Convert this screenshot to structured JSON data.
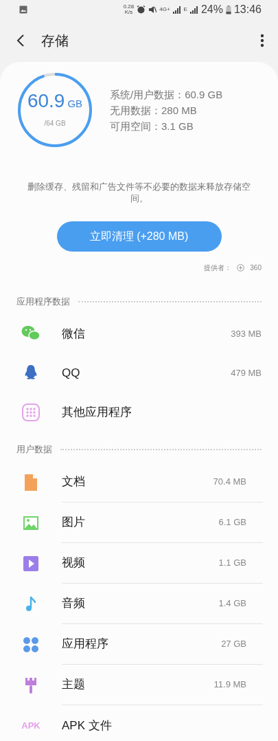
{
  "status_bar": {
    "speed": "0.28",
    "speed_unit": "K/s",
    "network": "4G+",
    "network2": "E",
    "battery": "24%",
    "time": "13:46"
  },
  "header": {
    "title": "存储"
  },
  "summary": {
    "used": "60.9",
    "used_unit": "GB",
    "total": "/64 GB",
    "level": 0.95,
    "details": [
      "系统/用户数据：60.9 GB",
      "无用数据：280 MB",
      "可用空间：3.1 GB"
    ],
    "description": "删除缓存、残留和广告文件等不必要的数据来释放存储空间。",
    "clean_button": "立即清理 (+280 MB)",
    "provider_label": "提供者：",
    "provider": "360"
  },
  "sections": [
    {
      "title": "应用程序数据",
      "divided": false,
      "items": [
        {
          "kind": "wechat",
          "label": "微信",
          "size": "393 MB"
        },
        {
          "kind": "qq",
          "label": "QQ",
          "size": "479 MB"
        },
        {
          "kind": "apps-grid",
          "label": "其他应用程序"
        }
      ]
    },
    {
      "title": "用户数据",
      "divided": true,
      "items": [
        {
          "kind": "document",
          "label": "文档",
          "size": "70.4 MB"
        },
        {
          "kind": "image",
          "label": "图片",
          "size": "6.1 GB"
        },
        {
          "kind": "video",
          "label": "视频",
          "size": "1.1 GB"
        },
        {
          "kind": "audio",
          "label": "音频",
          "size": "1.4 GB"
        },
        {
          "kind": "apps",
          "label": "应用程序",
          "size": "27 GB"
        },
        {
          "kind": "theme",
          "label": "主题",
          "size": "11.9 MB"
        },
        {
          "kind": "apk",
          "icon_text": "APK",
          "label": "APK 文件"
        }
      ]
    }
  ]
}
